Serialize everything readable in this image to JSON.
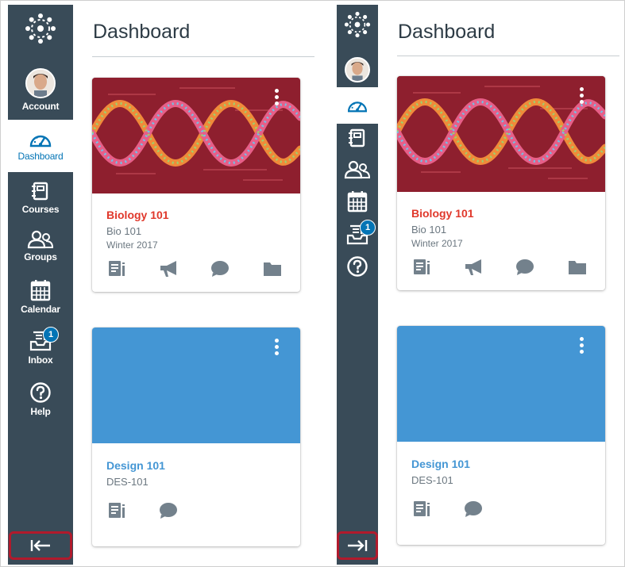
{
  "colors": {
    "nav_bg": "#394b58",
    "active_blue": "#0374b5",
    "collapse_highlight": "#b11a2c",
    "biology_red": "#e0382b",
    "design_blue": "#4496d4",
    "card_hero_dna": "#8e1f2e"
  },
  "left_panel": {
    "nav": [
      {
        "id": "logo",
        "icon": "canvas-logo-icon"
      },
      {
        "id": "account",
        "label": "Account",
        "icon": "avatar"
      },
      {
        "id": "dashboard",
        "label": "Dashboard",
        "icon": "dashboard-icon",
        "active": true
      },
      {
        "id": "courses",
        "label": "Courses",
        "icon": "courses-icon"
      },
      {
        "id": "groups",
        "label": "Groups",
        "icon": "groups-icon"
      },
      {
        "id": "calendar",
        "label": "Calendar",
        "icon": "calendar-icon"
      },
      {
        "id": "inbox",
        "label": "Inbox",
        "icon": "inbox-icon",
        "badge": "1"
      },
      {
        "id": "help",
        "label": "Help",
        "icon": "help-icon"
      }
    ],
    "collapse_button": {
      "icon": "collapse-arrow-left-icon"
    }
  },
  "right_panel": {
    "collapse_button": {
      "icon": "expand-arrow-right-icon"
    },
    "inbox_badge": "1"
  },
  "page_title": "Dashboard",
  "cards": [
    {
      "name": "Biology 101",
      "code": "Bio 101",
      "term": "Winter 2017",
      "image": "dna-image",
      "icons": [
        "assignments-icon",
        "announcements-icon",
        "discussions-icon",
        "files-icon"
      ]
    },
    {
      "name": "Design 101",
      "code": "DES-101",
      "term": "",
      "image": "solid-blue",
      "icons": [
        "assignments-icon",
        "discussions-icon"
      ]
    }
  ]
}
